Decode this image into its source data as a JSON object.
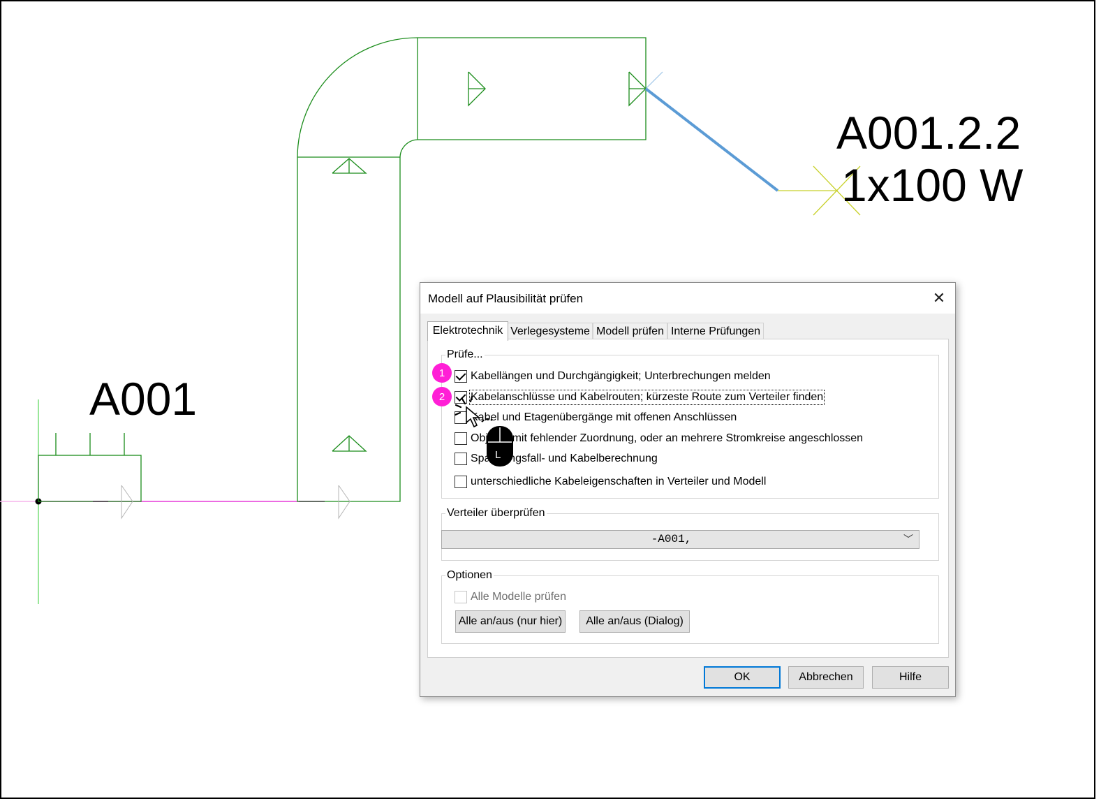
{
  "drawing": {
    "label_distributor": "A001",
    "label_circuit": "A001.2.2",
    "label_load": "1x100 W",
    "colors": {
      "tray": "#1a8c1a",
      "cable": "#5b9bd5",
      "wire": "#e53ad8",
      "cross": "#c8d12a",
      "axis_green": "#33cc33"
    }
  },
  "dialog": {
    "title": "Modell auf Plausibilität prüfen",
    "close_symbol": "✕",
    "tabs": [
      {
        "label": "Elektrotechnik",
        "active": true
      },
      {
        "label": "Verlegesysteme",
        "active": false
      },
      {
        "label": "Modell prüfen",
        "active": false
      },
      {
        "label": "Interne Prüfungen",
        "active": false
      }
    ],
    "check_group": {
      "label": "Prüfe...",
      "items": [
        {
          "label": "Kabellängen und Durchgängigkeit; Unterbrechungen melden",
          "checked": true
        },
        {
          "label": "Kabelanschlüsse und Kabelrouten; kürzeste Route zum Verteiler finden",
          "checked": true
        },
        {
          "label": "Kabel und Etagenübergänge mit offenen Anschlüssen",
          "checked": false
        },
        {
          "label": "Objekte mit fehlender Zuordnung, oder an mehrere Stromkreise angeschlossen",
          "checked": false
        },
        {
          "label": "Spannungsfall- und Kabelberechnung",
          "checked": false
        },
        {
          "label": "unterschiedliche Kabeleigenschaften in Verteiler und Modell",
          "checked": false
        }
      ]
    },
    "distributor_group": {
      "label": "Verteiler überprüfen",
      "selected": "-A001,"
    },
    "options_group": {
      "label": "Optionen",
      "all_models_label": "Alle Modelle prüfen",
      "all_models_checked": false,
      "toggle_here_label": "Alle an/aus (nur hier)",
      "toggle_dialog_label": "Alle an/aus (Dialog)"
    },
    "buttons": {
      "ok": "OK",
      "cancel": "Abbrechen",
      "help": "Hilfe"
    }
  },
  "annotations": {
    "badges": [
      "1",
      "2"
    ],
    "badge_color": "#ff1fd6",
    "mouse_button_label": "L"
  }
}
